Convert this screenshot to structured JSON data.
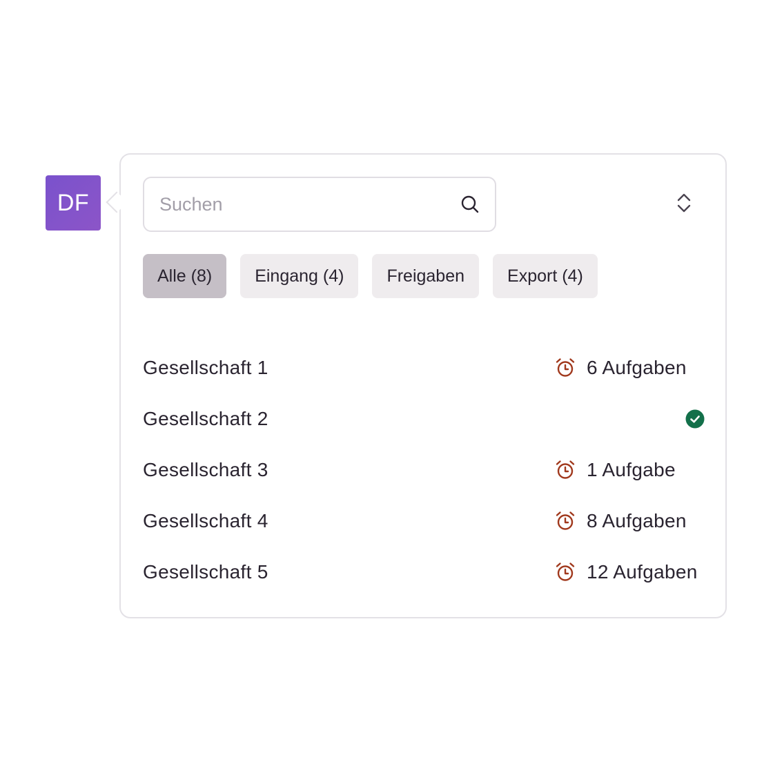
{
  "avatar": {
    "initials": "DF",
    "color": "#7e53cb"
  },
  "search": {
    "placeholder": "Suchen",
    "value": "",
    "icon": "search-icon"
  },
  "sort": {
    "icon": "chevron-up-down-icon"
  },
  "filters": [
    {
      "label": "Alle (8)",
      "active": true
    },
    {
      "label": "Eingang (4)",
      "active": false
    },
    {
      "label": "Freigaben",
      "active": false
    },
    {
      "label": "Export (4)",
      "active": false
    }
  ],
  "companies": [
    {
      "name": "Gesellschaft 1",
      "status": "tasks",
      "tasks": "6 Aufgaben",
      "icon": "alarm-clock-icon"
    },
    {
      "name": "Gesellschaft 2",
      "status": "done",
      "tasks": "",
      "icon": "check-circle-icon"
    },
    {
      "name": "Gesellschaft 3",
      "status": "tasks",
      "tasks": "1 Aufgabe",
      "icon": "alarm-clock-icon"
    },
    {
      "name": "Gesellschaft 4",
      "status": "tasks",
      "tasks": "8 Aufgaben",
      "icon": "alarm-clock-icon"
    },
    {
      "name": "Gesellschaft 5",
      "status": "tasks",
      "tasks": "12 Aufgaben",
      "icon": "alarm-clock-icon"
    }
  ],
  "colors": {
    "alarm": "#a0381c",
    "done": "#13704a",
    "chip_active": "#c5bfc6",
    "chip": "#efecee"
  }
}
